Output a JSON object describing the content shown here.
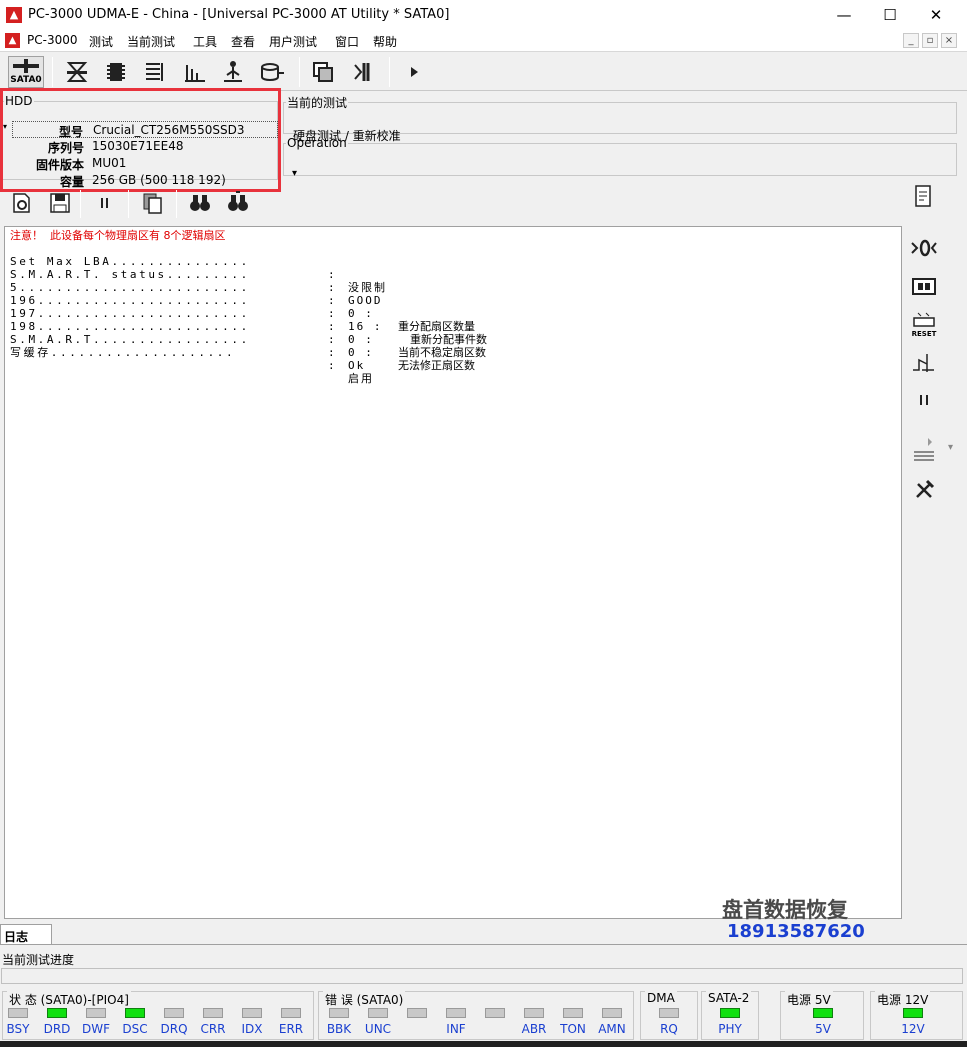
{
  "window": {
    "title": "PC-3000 UDMA-E - China - [Universal PC-3000 AT Utility * SATA0]",
    "app_icon": "pc3000-logo-icon",
    "minimize": "—",
    "maximize": "☐",
    "close": "✕"
  },
  "menu": {
    "items": [
      "PC-3000",
      "测试",
      "当前测试",
      "工具",
      "查看",
      "用户测试",
      "窗口",
      "帮助"
    ],
    "mdi_buttons": [
      "_",
      "▫",
      "×"
    ]
  },
  "toolbar": {
    "sata_label": "SATA0",
    "icons": [
      "sata-port-icon",
      "drive-select-icon",
      "chip-icon",
      "list-icon",
      "chart-icon",
      "tree-icon",
      "disk-icon",
      "windows-icon",
      "run-icon",
      "play-icon"
    ]
  },
  "hdd": {
    "legend": "HDD",
    "rows": [
      {
        "label": "型号",
        "value": "Crucial_CT256M550SSD3"
      },
      {
        "label": "序列号",
        "value": "15030E71EE48"
      },
      {
        "label": "固件版本",
        "value": "MU01"
      },
      {
        "label": "容量",
        "value": "256 GB (500 118 192)"
      }
    ]
  },
  "current_test": {
    "legend": "当前的测试",
    "value": "硬盘测试 / 重新校准"
  },
  "operation": {
    "legend": "Operation",
    "dropdown": "▾"
  },
  "log": {
    "warning": "注意！  此设备每个物理扇区有 8个逻辑扇区",
    "lines": [
      {
        "key": "Set Max LBA...............",
        "col": ":",
        "val": "没限制",
        "desc": ""
      },
      {
        "key": "S.M.A.R.T. status.........",
        "col": ":",
        "val": "GOOD",
        "desc": ""
      },
      {
        "key": "5.........................",
        "col": ":",
        "val": "0 :",
        "desc": "重分配扇区数量"
      },
      {
        "key": "196.......................",
        "col": ":",
        "val": "16 :",
        "desc": "重新分配事件数"
      },
      {
        "key": "197.......................",
        "col": ":",
        "val": "0 :",
        "desc": "当前不稳定扇区数"
      },
      {
        "key": "198.......................",
        "col": ":",
        "val": "0 :",
        "desc": "无法修正扇区数"
      },
      {
        "key": "S.M.A.R.T.................",
        "col": ":",
        "val": "Ok",
        "desc": ""
      },
      {
        "key": "写缓存....................",
        "col": ":",
        "val": "启用",
        "desc": ""
      }
    ]
  },
  "right_toolbar": {
    "reset_label": "RESET",
    "icons": [
      "scroll-icon",
      "power-zero-icon",
      "board-icon",
      "reset-icon",
      "relay-icon",
      "pause-icon",
      "stack-icon",
      "tools-icon"
    ]
  },
  "watermark": {
    "line1": "盘首数据恢复",
    "line2": "18913587620"
  },
  "tabs": {
    "log": "日志"
  },
  "progress": {
    "label": "当前测试进度"
  },
  "status": {
    "state_legend": "状 态 (SATA0)-[PIO4]",
    "state_leds": [
      {
        "label": "BSY",
        "on": false
      },
      {
        "label": "DRD",
        "on": true
      },
      {
        "label": "DWF",
        "on": false
      },
      {
        "label": "DSC",
        "on": true
      },
      {
        "label": "DRQ",
        "on": false
      },
      {
        "label": "CRR",
        "on": false
      },
      {
        "label": "IDX",
        "on": false
      },
      {
        "label": "ERR",
        "on": false
      }
    ],
    "error_legend": "错 误 (SATA0)",
    "error_leds": [
      {
        "label": "BBK",
        "on": false
      },
      {
        "label": "UNC",
        "on": false
      },
      {
        "label": "",
        "on": false
      },
      {
        "label": "INF",
        "on": false
      },
      {
        "label": "",
        "on": false
      },
      {
        "label": "ABR",
        "on": false
      },
      {
        "label": "TON",
        "on": false
      },
      {
        "label": "AMN",
        "on": false
      }
    ],
    "dma_legend": "DMA",
    "dma_led": {
      "label": "RQ",
      "on": false
    },
    "sata_legend": "SATA-2",
    "sata_led": {
      "label": "PHY",
      "on": true
    },
    "p5_legend": "电源 5V",
    "p5_led": {
      "label": "5V",
      "on": true
    },
    "p12_legend": "电源 12V",
    "p12_led": {
      "label": "12V",
      "on": true
    },
    "colors": {
      "led_on": "#10e010",
      "led_off": "#c8c8c8",
      "label": "#1a3fd0"
    }
  }
}
